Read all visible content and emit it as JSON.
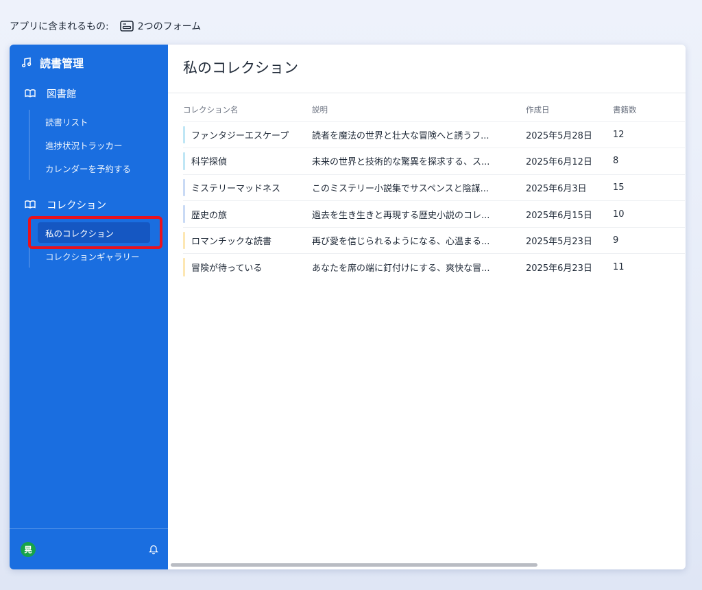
{
  "topbar": {
    "label": "アプリに含まれるもの:",
    "forms_text": "2つのフォーム"
  },
  "sidebar": {
    "brand": "読書管理",
    "sections": [
      {
        "title": "図書館",
        "items": [
          {
            "label": "読書リスト"
          },
          {
            "label": "進捗状況トラッカー"
          },
          {
            "label": "カレンダーを予約する"
          }
        ]
      },
      {
        "title": "コレクション",
        "items": [
          {
            "label": "私のコレクション"
          },
          {
            "label": "コレクションギャラリー"
          }
        ]
      }
    ],
    "footer": {
      "avatar_initial": "晃"
    }
  },
  "main": {
    "title": "私のコレクション",
    "columns": [
      "コレクション名",
      "説明",
      "作成日",
      "書籍数"
    ],
    "rows": [
      {
        "name": "ファンタジーエスケープ",
        "desc": "読者を魔法の世界と壮大な冒険へと誘うフ...",
        "date": "2025年5月28日",
        "count": "12",
        "color": "#bfe6f5"
      },
      {
        "name": "科学探偵",
        "desc": "未来の世界と技術的な驚異を探求する、ス...",
        "date": "2025年6月12日",
        "count": "8",
        "color": "#bfe6f5"
      },
      {
        "name": "ミステリーマッドネス",
        "desc": "このミステリー小説集でサスペンスと陰謀...",
        "date": "2025年6月3日",
        "count": "15",
        "color": "#c9daf5"
      },
      {
        "name": "歴史の旅",
        "desc": "過去を生き生きと再現する歴史小説のコレ...",
        "date": "2025年6月15日",
        "count": "10",
        "color": "#c9daf5"
      },
      {
        "name": "ロマンチックな読書",
        "desc": "再び愛を信じられるようになる、心温まる...",
        "date": "2025年5月23日",
        "count": "9",
        "color": "#fde7b3"
      },
      {
        "name": "冒険が待っている",
        "desc": "あなたを席の端に釘付けにする、爽快な冒...",
        "date": "2025年6月23日",
        "count": "11",
        "color": "#fde7b3"
      }
    ]
  }
}
